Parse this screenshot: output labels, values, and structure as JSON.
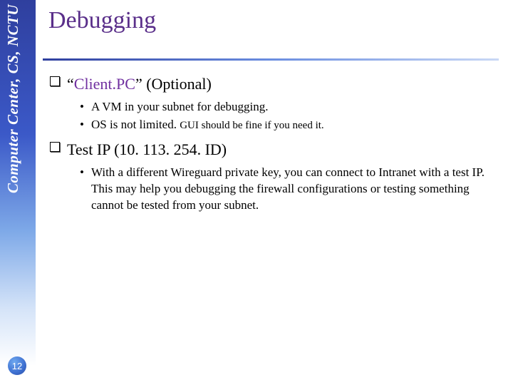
{
  "sidebar": {
    "label": "Computer Center, CS, NCTU"
  },
  "title": "Debugging",
  "page_number": "12",
  "sections": [
    {
      "heading_prefix": "“",
      "heading_link": "Client.PC",
      "heading_suffix": "” (Optional)",
      "bullets": [
        {
          "text": "A VM in your subnet for debugging."
        },
        {
          "text_main": "OS is not limited. ",
          "text_fine": "GUI should be fine if you need it."
        }
      ]
    },
    {
      "heading": "Test IP (10. 113. 254. ID)",
      "bullets": [
        {
          "text": "With a different Wireguard private key, you can connect to Intranet with a test IP. This may help you debugging the firewall configurations or testing something cannot be tested from your subnet."
        }
      ]
    }
  ]
}
